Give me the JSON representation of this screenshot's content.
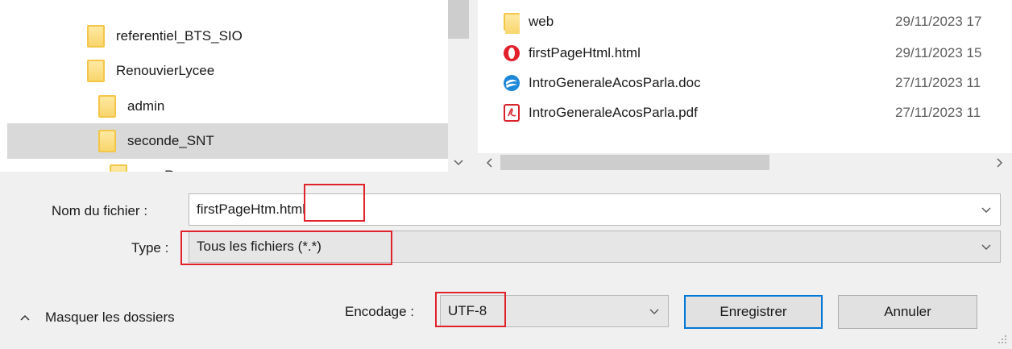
{
  "tree": {
    "items": [
      {
        "label": "referentiel_BTS_SIO",
        "selected": false
      },
      {
        "label": "RenouvierLycee",
        "selected": false
      },
      {
        "label": "admin",
        "selected": false
      },
      {
        "label": "seconde_SNT",
        "selected": true
      },
      {
        "label": "mayRo",
        "selected": false
      }
    ],
    "scroll_down_icon": "chevron-down-icon"
  },
  "files": {
    "rows": [
      {
        "name": "web",
        "date": "29/11/2023 17",
        "icon": "folder-icon"
      },
      {
        "name": "firstPageHtml.html",
        "date": "29/11/2023 15",
        "icon": "opera-icon"
      },
      {
        "name": "IntroGeneraleAcosParla.doc",
        "date": "27/11/2023 11",
        "icon": "libreoffice-writer-icon"
      },
      {
        "name": "IntroGeneraleAcosParla.pdf",
        "date": "27/11/2023 11",
        "icon": "pdf-icon"
      }
    ],
    "scroll_left_icon": "chevron-left-icon",
    "scroll_right_icon": "chevron-right-icon"
  },
  "form": {
    "filename_label": "Nom du fichier :",
    "filename_value_part1": "firstPageHtm",
    "filename_value_part2": ".html",
    "type_label": "Type :",
    "type_value": "Tous les fichiers  (*.*)",
    "encoding_label": "Encodage :",
    "encoding_value": "UTF-8"
  },
  "footer": {
    "toggle_label": "Masquer les dossiers",
    "save_label": "Enregistrer",
    "cancel_label": "Annuler"
  },
  "colors": {
    "highlight_box": "#e0232b",
    "primary_button_border": "#0078d7",
    "folder": "#f3c648",
    "selection": "#d9d9d9"
  }
}
